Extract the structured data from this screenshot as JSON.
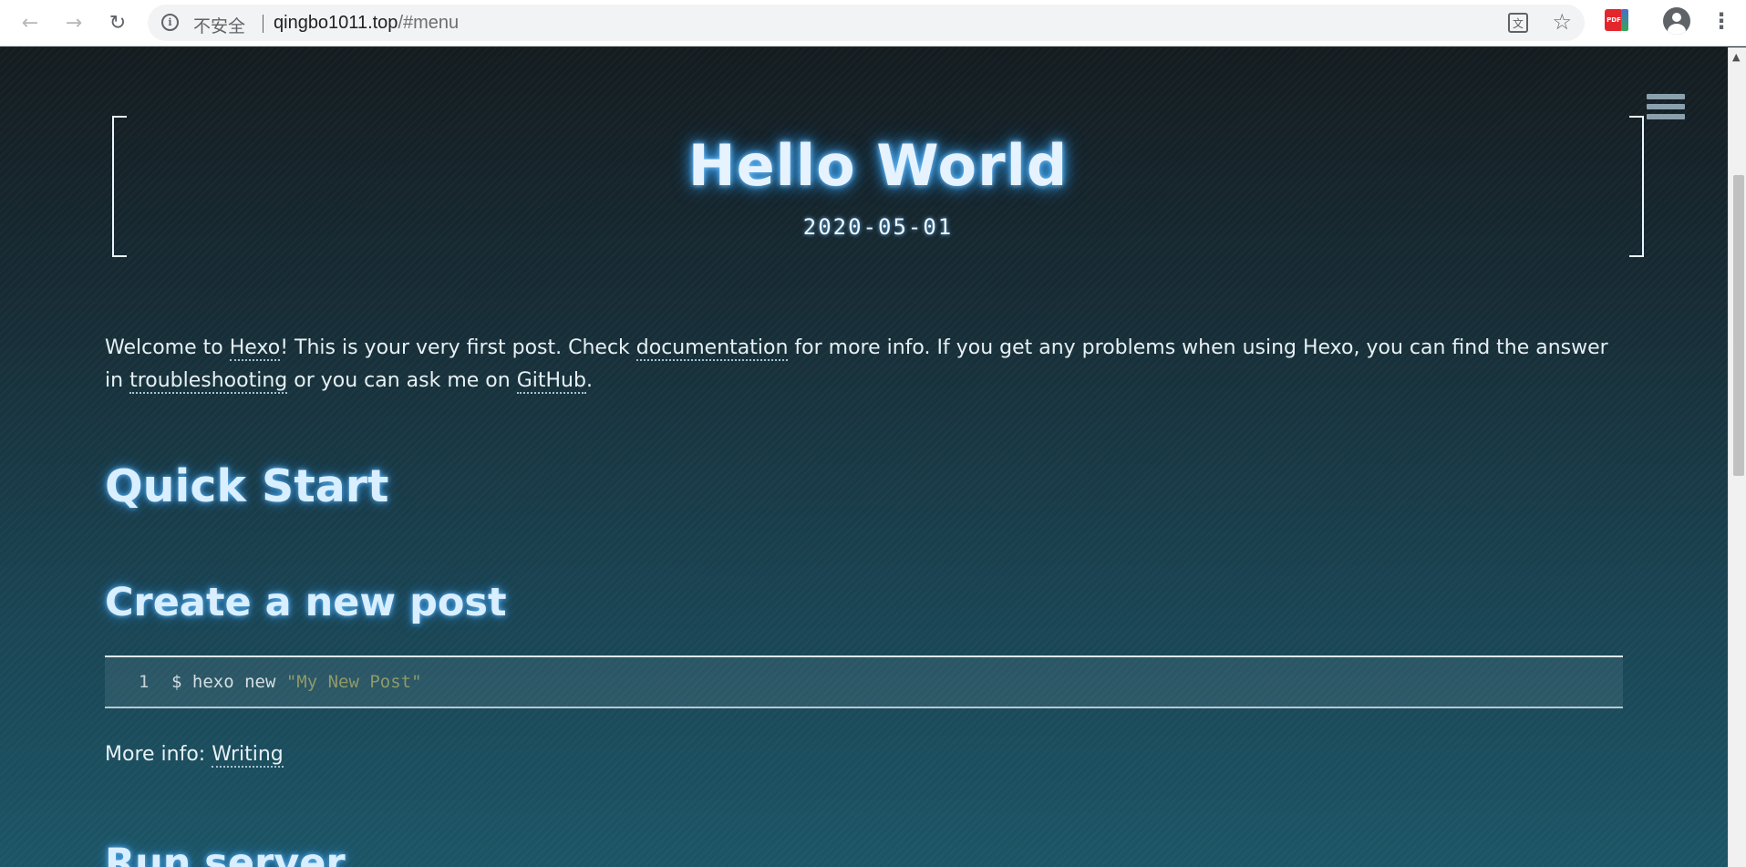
{
  "browser": {
    "security_label": "不安全",
    "url_host": "qingbo1011.top",
    "url_path": "/#menu",
    "info_icon": "i",
    "translate_icon": "文",
    "pdf_ext_label": "PDF"
  },
  "post": {
    "title": "Hello World",
    "date": "2020-05-01",
    "intro": {
      "t1": "Welcome to ",
      "link_hexo": "Hexo",
      "t2": "! This is your very first post. Check ",
      "link_docs": "documentation",
      "t3": " for more info. If you get any problems when using Hexo, you can find the answer in ",
      "link_troubleshooting": "troubleshooting",
      "t4": " or you can ask me on ",
      "link_github": "GitHub",
      "t5": "."
    },
    "heading_quick_start": "Quick Start",
    "heading_create_post": "Create a new post",
    "code": {
      "line_number": "1",
      "command": "$ hexo new ",
      "argument": "\"My New Post\""
    },
    "more_info_label": "More info: ",
    "more_info_link": "Writing",
    "heading_run_server": "Run server"
  }
}
